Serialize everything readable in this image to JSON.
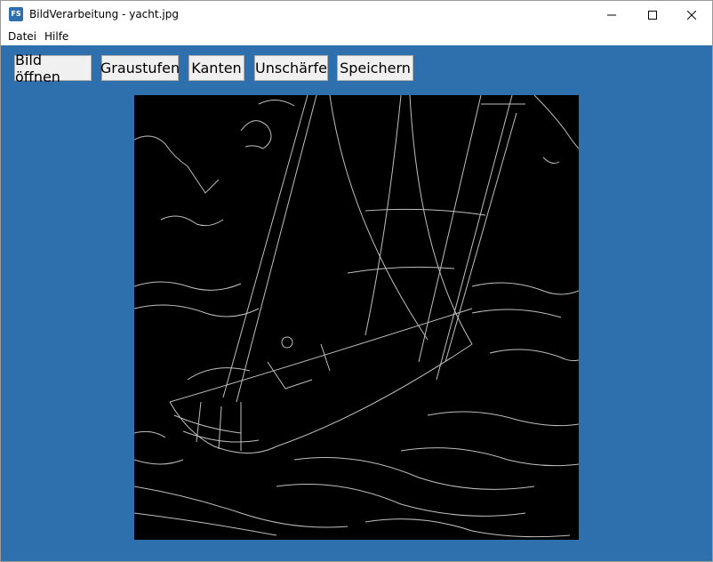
{
  "window": {
    "title": "BildVerarbeitung - yacht.jpg",
    "app_icon_text": "FS"
  },
  "menu": {
    "items": [
      "Datei",
      "Hilfe"
    ]
  },
  "toolbar": {
    "buttons": [
      "Bild öffnen",
      "Graustufen",
      "Kanten",
      "Unschärfe",
      "Speichern"
    ]
  },
  "colors": {
    "client_background": "#2e6fae",
    "image_background": "#000000",
    "edge_stroke": "#bfbfbf"
  },
  "image": {
    "content": "edge-detected sailing yacht"
  }
}
